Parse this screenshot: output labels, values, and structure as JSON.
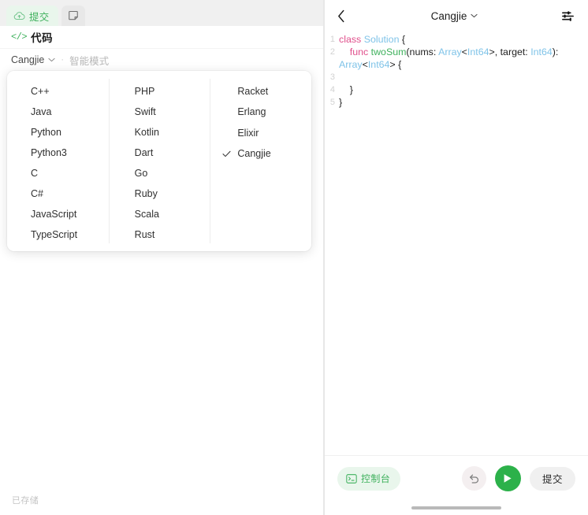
{
  "left_panel": {
    "tabs": [
      {
        "id": "submit",
        "label": "提交",
        "icon": "cloud-upload-icon",
        "active": true
      },
      {
        "id": "note",
        "label": "",
        "icon": "note-icon",
        "active": false
      }
    ],
    "section": {
      "code_glyph": "</>",
      "title": "代码"
    },
    "language_bar": {
      "current_language": "Cangjie",
      "separator": "·",
      "mode_label": "智能模式"
    },
    "status": {
      "saved_text": "已存储"
    },
    "language_dropdown": {
      "visible": true,
      "selected": "Cangjie",
      "check_glyph": "✓",
      "columns": [
        {
          "items": [
            "C++",
            "Java",
            "Python",
            "Python3",
            "C",
            "C#",
            "JavaScript",
            "TypeScript"
          ]
        },
        {
          "items": [
            "PHP",
            "Swift",
            "Kotlin",
            "Dart",
            "Go",
            "Ruby",
            "Scala",
            "Rust"
          ]
        },
        {
          "items": [
            "Racket",
            "Erlang",
            "Elixir",
            "Cangjie"
          ]
        }
      ]
    }
  },
  "right_panel": {
    "header": {
      "back_icon": "chevron-left-icon",
      "title": "Cangjie",
      "title_chevron": "chevron-down-icon",
      "settings_icon": "sliders-icon"
    },
    "editor": {
      "lines": [
        {
          "number": "1",
          "tokens": [
            {
              "text": "class ",
              "type": "kw"
            },
            {
              "text": "Solution",
              "type": "type"
            },
            {
              "text": " {",
              "type": "plain"
            }
          ]
        },
        {
          "number": "2",
          "tokens": [
            {
              "text": "    ",
              "type": "plain"
            },
            {
              "text": "func ",
              "type": "kw"
            },
            {
              "text": "twoSum",
              "type": "fn"
            },
            {
              "text": "(nums: ",
              "type": "plain"
            },
            {
              "text": "Array",
              "type": "type"
            },
            {
              "text": "<",
              "type": "plain"
            },
            {
              "text": "Int64",
              "type": "type"
            },
            {
              "text": ">, target: ",
              "type": "plain"
            },
            {
              "text": "Int64",
              "type": "type"
            },
            {
              "text": "): ",
              "type": "plain"
            },
            {
              "text": "Array",
              "type": "type"
            },
            {
              "text": "<",
              "type": "plain"
            },
            {
              "text": "Int64",
              "type": "type"
            },
            {
              "text": "> {",
              "type": "plain"
            }
          ]
        },
        {
          "number": "3",
          "tokens": [
            {
              "text": "",
              "type": "plain"
            }
          ]
        },
        {
          "number": "4",
          "tokens": [
            {
              "text": "    }",
              "type": "plain"
            }
          ]
        },
        {
          "number": "5",
          "tokens": [
            {
              "text": "}",
              "type": "plain"
            }
          ]
        }
      ]
    },
    "action_bar": {
      "console_label": "控制台",
      "console_icon": "terminal-icon",
      "undo_icon": "undo-icon",
      "run_icon": "play-icon",
      "submit_label": "提交"
    }
  },
  "colors": {
    "accent_green": "#3fb15d",
    "run_green": "#2cb14a",
    "keyword_pink": "#e0508c",
    "type_blue": "#7fc3e8",
    "function_green": "#3fb15d",
    "panel_bg": "#ffffff",
    "chrome_bg": "#f0f0f0"
  }
}
